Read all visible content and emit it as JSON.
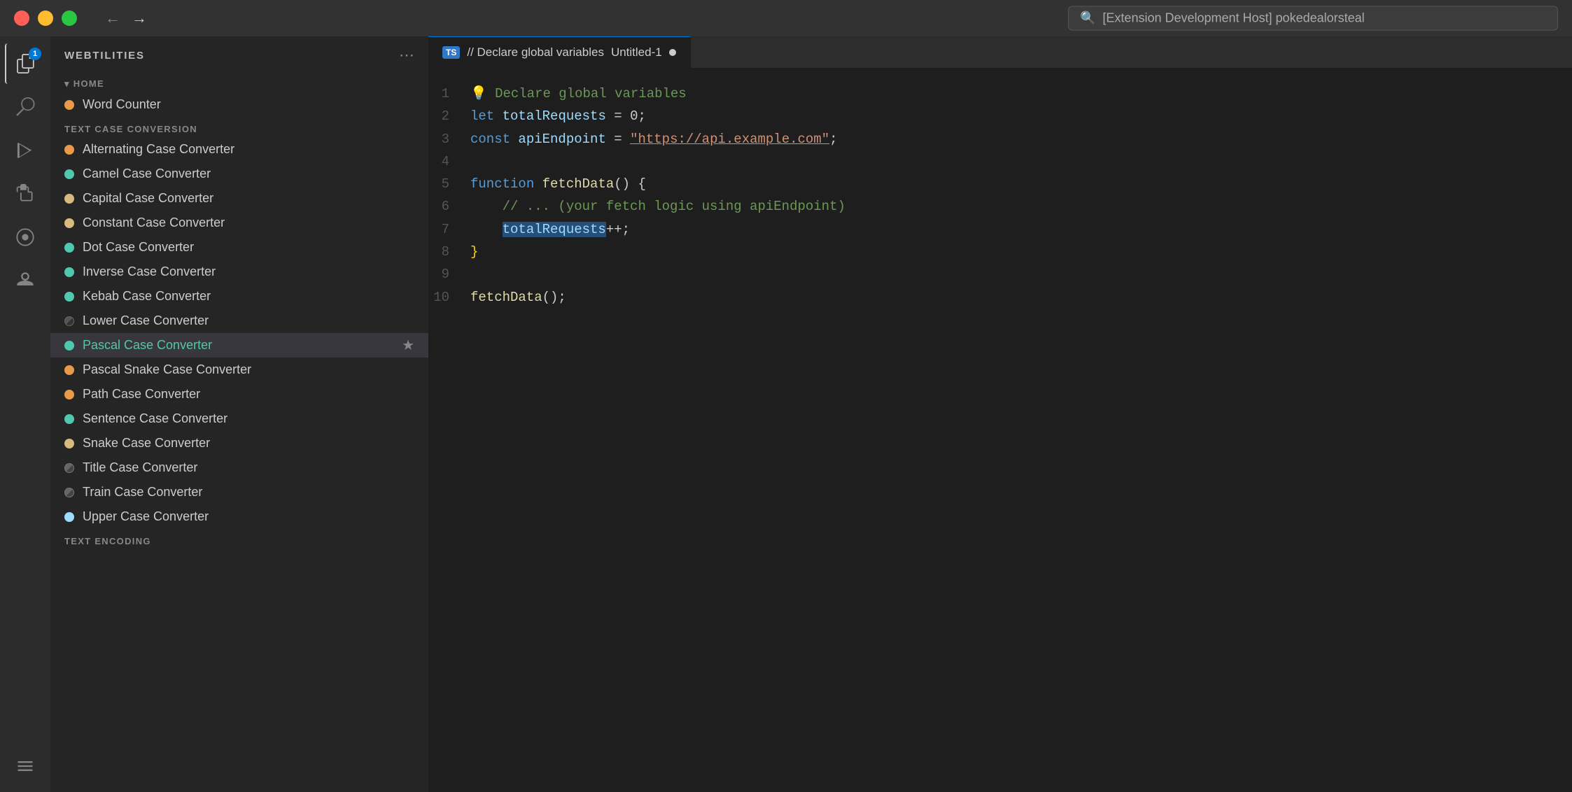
{
  "titleBar": {
    "searchPlaceholder": "[Extension Development Host] pokedealorsteal",
    "backArrow": "←",
    "forwardArrow": "→"
  },
  "sidebar": {
    "title": "WEBTILITIES",
    "moreIcon": "⋯",
    "homeSection": {
      "label": "HOME",
      "items": [
        {
          "id": "word-counter",
          "label": "Word Counter",
          "dotColor": "dot-orange"
        }
      ]
    },
    "textCaseSection": {
      "label": "TEXT CASE CONVERSION",
      "items": [
        {
          "id": "alternating-case",
          "label": "Alternating Case Converter",
          "dotColor": "dot-orange"
        },
        {
          "id": "camel-case",
          "label": "Camel Case Converter",
          "dotColor": "dot-green"
        },
        {
          "id": "capital-case",
          "label": "Capital Case Converter",
          "dotColor": "dot-yellow"
        },
        {
          "id": "constant-case",
          "label": "Constant Case Converter",
          "dotColor": "dot-yellow"
        },
        {
          "id": "dot-case",
          "label": "Dot Case Converter",
          "dotColor": "dot-green"
        },
        {
          "id": "inverse-case",
          "label": "Inverse Case Converter",
          "dotColor": "dot-green"
        },
        {
          "id": "kebab-case",
          "label": "Kebab Case Converter",
          "dotColor": "dot-green"
        },
        {
          "id": "lower-case",
          "label": "Lower Case Converter",
          "dotColor": "dot-dark"
        },
        {
          "id": "pascal-case",
          "label": "Pascal Case Converter",
          "dotColor": "dot-blue",
          "active": true,
          "star": true
        },
        {
          "id": "pascal-snake-case",
          "label": "Pascal Snake Case Converter",
          "dotColor": "dot-orange"
        },
        {
          "id": "path-case",
          "label": "Path Case Converter",
          "dotColor": "dot-orange"
        },
        {
          "id": "sentence-case",
          "label": "Sentence Case Converter",
          "dotColor": "dot-green"
        },
        {
          "id": "snake-case",
          "label": "Snake Case Converter",
          "dotColor": "dot-yellow"
        },
        {
          "id": "title-case",
          "label": "Title Case Converter",
          "dotColor": "dot-dark2"
        },
        {
          "id": "train-case",
          "label": "Train Case Converter",
          "dotColor": "dot-dark2"
        },
        {
          "id": "upper-case",
          "label": "Upper Case Converter",
          "dotColor": "dot-light"
        }
      ]
    },
    "textEncodingSection": {
      "label": "TEXT ENCODING"
    }
  },
  "editor": {
    "tabLabel": "// Declare global variables",
    "tabFile": "Untitled-1",
    "tsLabel": "TS",
    "lines": [
      {
        "num": "1",
        "content": "💡 Declare global variables",
        "type": "comment"
      },
      {
        "num": "2",
        "content": "let totalRequests = 0;",
        "type": "code"
      },
      {
        "num": "3",
        "content": "const apiEndpoint = \"https://api.example.com\";",
        "type": "code"
      },
      {
        "num": "4",
        "content": "",
        "type": "empty"
      },
      {
        "num": "5",
        "content": "function fetchData() {",
        "type": "code"
      },
      {
        "num": "6",
        "content": "    // ... (your fetch logic using apiEndpoint)",
        "type": "comment"
      },
      {
        "num": "7",
        "content": "    totalRequests++;",
        "type": "code-highlight"
      },
      {
        "num": "8",
        "content": "}",
        "type": "code"
      },
      {
        "num": "9",
        "content": "",
        "type": "empty"
      },
      {
        "num": "10",
        "content": "fetchData();",
        "type": "code"
      }
    ]
  },
  "activityBar": {
    "items": [
      {
        "id": "explorer",
        "icon": "📄",
        "badge": "1"
      },
      {
        "id": "search",
        "icon": "🔍"
      },
      {
        "id": "run",
        "icon": "▷"
      },
      {
        "id": "extensions",
        "icon": "⊞"
      },
      {
        "id": "remote",
        "icon": "◉"
      },
      {
        "id": "accounts",
        "icon": "◎"
      },
      {
        "id": "webtilities",
        "icon": "⚡",
        "bottom": true
      }
    ]
  }
}
